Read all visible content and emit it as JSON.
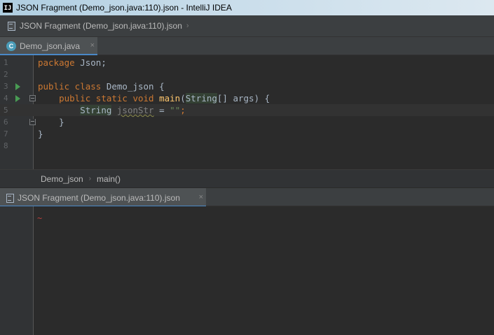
{
  "window": {
    "title": "JSON Fragment (Demo_json.java:110).json - IntelliJ IDEA",
    "app_icon_text": "IJ"
  },
  "navbar": {
    "file_label": "JSON Fragment (Demo_json.java:110).json"
  },
  "editor_tab": {
    "label": "Demo_json.java",
    "class_icon_letter": "C",
    "close_glyph": "×"
  },
  "editor": {
    "line_numbers": [
      "1",
      "2",
      "3",
      "4",
      "5",
      "6",
      "7",
      "8"
    ],
    "current_line": "5"
  },
  "breadcrumbs": {
    "class_name": "Demo_json",
    "method_name": "main()"
  },
  "panel": {
    "tab_label": "JSON Fragment (Demo_json.java:110).json",
    "close_glyph": "×",
    "error_marker": "~"
  },
  "colors": {
    "keyword": "#cc7832",
    "function": "#ffc66d",
    "string": "#6a8759",
    "text": "#a9b7c6",
    "run_icon": "#499c54",
    "tab_underline": "#4a88c7",
    "error": "#bc3f3c"
  }
}
